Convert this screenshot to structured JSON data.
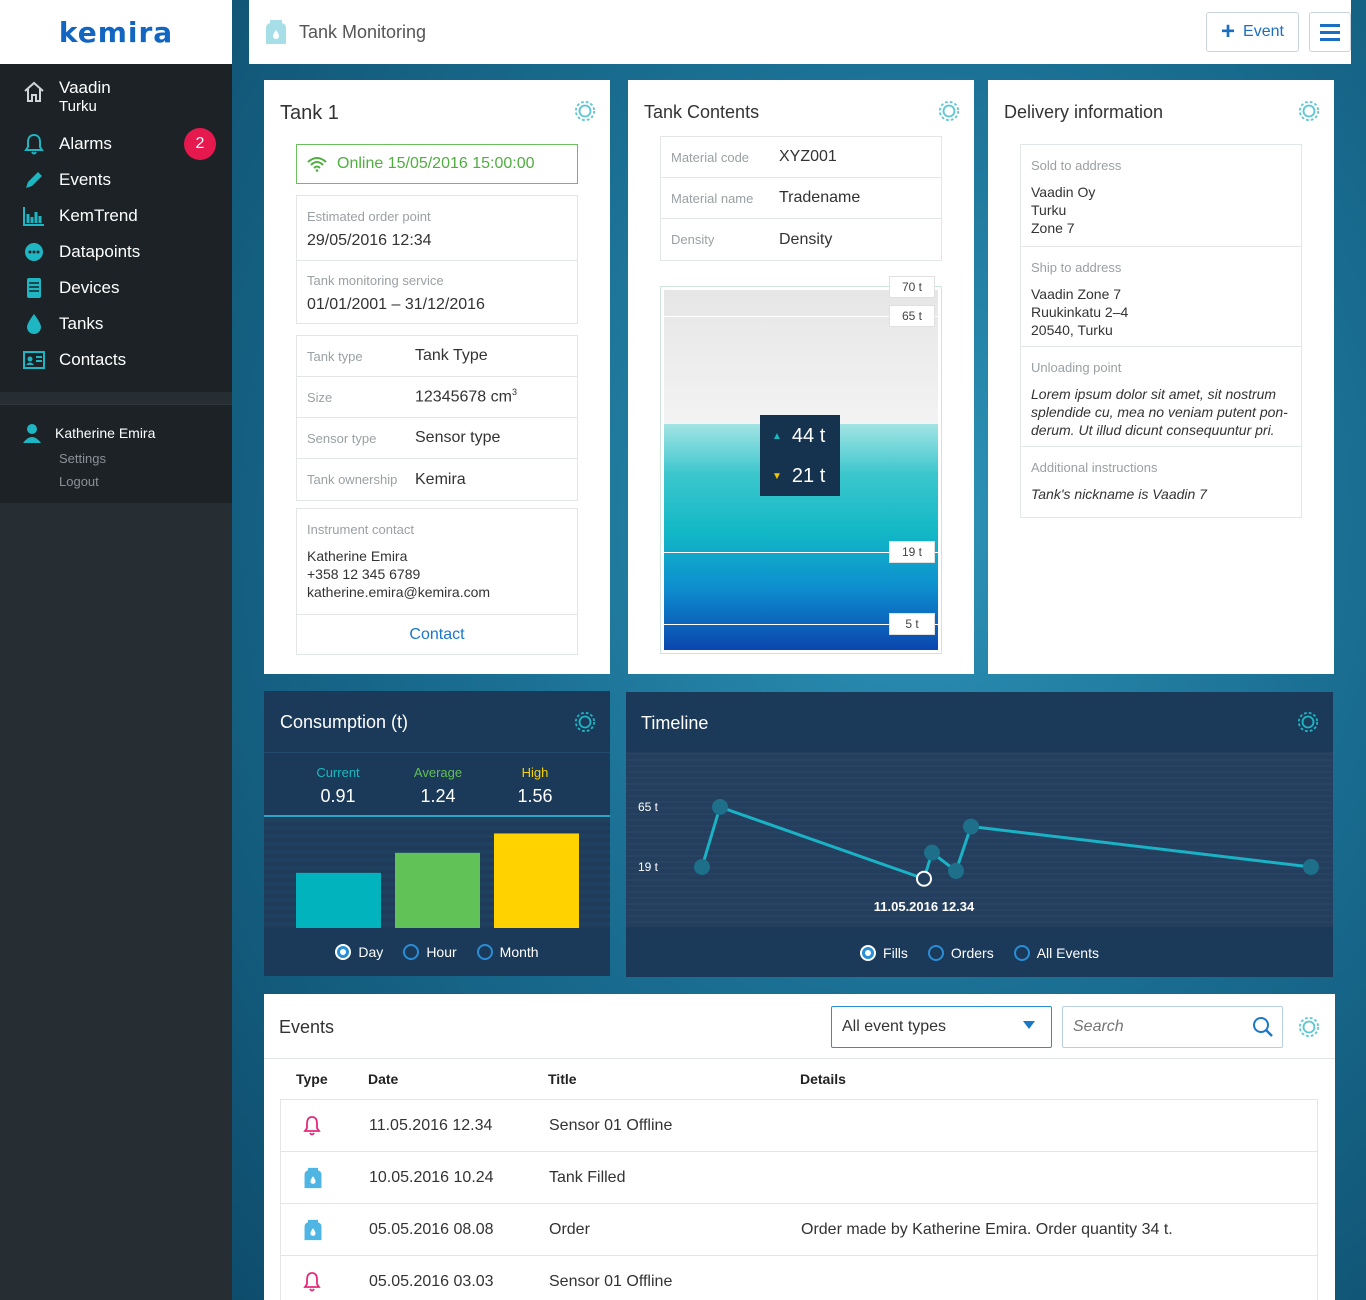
{
  "brand": {
    "logo": "kemira"
  },
  "sidebar": {
    "home": {
      "name": "Vaadin",
      "city": "Turku"
    },
    "items": [
      {
        "label": "Alarms",
        "icon": "bell-icon",
        "badge": "2"
      },
      {
        "label": "Events",
        "icon": "pencil-icon"
      },
      {
        "label": "KemTrend",
        "icon": "trend-chart-icon"
      },
      {
        "label": "Datapoints",
        "icon": "datapoints-icon"
      },
      {
        "label": "Devices",
        "icon": "device-icon"
      },
      {
        "label": "Tanks",
        "icon": "drop-icon"
      },
      {
        "label": "Contacts",
        "icon": "contact-card-icon"
      }
    ],
    "user": {
      "name": "Katherine Emira",
      "settings": "Settings",
      "logout": "Logout"
    }
  },
  "topbar": {
    "title": "Tank Monitoring",
    "event_button": "Event"
  },
  "tank": {
    "title": "Tank 1",
    "status": "Online 15/05/2016 15:00:00",
    "order_point_label": "Estimated order point",
    "order_point_value": "29/05/2016 12:34",
    "service_label": "Tank monitoring service",
    "service_value": "01/01/2001 – 31/12/2016",
    "props": [
      {
        "label": "Tank type",
        "value": "Tank Type"
      },
      {
        "label": "Size",
        "value": "12345678 cm",
        "sup": "3"
      },
      {
        "label": "Sensor type",
        "value": "Sensor type"
      },
      {
        "label": "Tank ownership",
        "value": "Kemira"
      }
    ],
    "contact_label": "Instrument contact",
    "contact_name": "Katherine Emira",
    "contact_phone": "+358 12 345 6789",
    "contact_email": "katherine.emira@kemira.com",
    "contact_button": "Contact"
  },
  "contents": {
    "title": "Tank Contents",
    "props": [
      {
        "label": "Material code",
        "value": "XYZ001"
      },
      {
        "label": "Material name",
        "value": "Tradename"
      },
      {
        "label": "Density",
        "value": "Density"
      }
    ],
    "gauge": {
      "max_label": "70 t",
      "high_label": "65 t",
      "mid_label": "19 t",
      "low_label": "5 t",
      "max": 70,
      "high": 65,
      "mid": 19,
      "low": 5,
      "fill_level": 44,
      "up_value": "44 t",
      "down_value": "21 t"
    }
  },
  "delivery": {
    "title": "Delivery information",
    "sold_label": "Sold to address",
    "sold_lines": [
      "Vaadin Oy",
      "Turku",
      "Zone 7"
    ],
    "ship_label": "Ship to address",
    "ship_lines": [
      "Vaadin Zone 7",
      "Ruukinkatu 2–4",
      "20540, Turku"
    ],
    "unloading_label": "Unloading point",
    "unloading_text": "Lorem ipsum dolor sit amet, sit nostrum splendide cu, mea no veniam putent pon-derum. Ut illud dicunt consequuntur pri.",
    "additional_label": "Additional instructions",
    "additional_text": "Tank's nickname is Vaadin 7"
  },
  "consumption": {
    "title": "Consumption (t)",
    "stats": [
      {
        "label": "Current",
        "value": "0.91",
        "color": "#19b9c0"
      },
      {
        "label": "Average",
        "value": "1.24",
        "color": "#62c054"
      },
      {
        "label": "High",
        "value": "1.56",
        "color": "#f7d100"
      }
    ],
    "options": [
      "Day",
      "Hour",
      "Month"
    ],
    "selected": "Day"
  },
  "chart_data": {
    "type": "bar",
    "categories": [
      "Current",
      "Average",
      "High"
    ],
    "values": [
      0.91,
      1.24,
      1.56
    ],
    "ylim": [
      0,
      1.65
    ],
    "colors": [
      "#00b3bd",
      "#61c257",
      "#ffd200"
    ]
  },
  "timeline": {
    "title": "Timeline",
    "y_labels": [
      "65 t",
      "19 t"
    ],
    "tooltip": "11.05.2016 12.34",
    "options": [
      "Fills",
      "Orders",
      "All Events"
    ],
    "selected": "Fills",
    "points": [
      19,
      65,
      10,
      30,
      16,
      50,
      19
    ]
  },
  "events": {
    "title": "Events",
    "filter": "All event types",
    "search_placeholder": "Search",
    "columns": [
      "Type",
      "Date",
      "Title",
      "Details"
    ],
    "rows": [
      {
        "type": "bell-icon",
        "date": "11.05.2016 12.34",
        "title": "Sensor 01 Offline",
        "details": ""
      },
      {
        "type": "tank-icon",
        "date": "10.05.2016 10.24",
        "title": "Tank Filled",
        "details": ""
      },
      {
        "type": "tank-icon",
        "date": "05.05.2016 08.08",
        "title": "Order",
        "details": "Order made by Katherine Emira. Order quantity 34 t."
      },
      {
        "type": "bell-icon",
        "date": "05.05.2016 03.03",
        "title": "Sensor 01 Offline",
        "details": ""
      }
    ]
  }
}
